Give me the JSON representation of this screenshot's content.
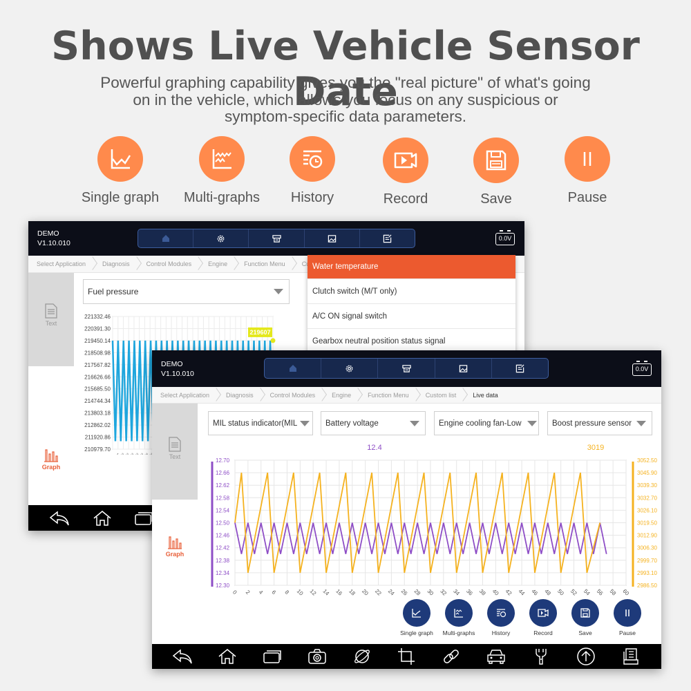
{
  "banner": {
    "title": "Shows Live Vehicle Sensor Date",
    "subtitle_lines": [
      "Powerful graphing capability gives you the \"real picture\" of what's  going",
      "on in the vehicle, which allows you focus on any suspicious or",
      "symptom-specific data parameters."
    ],
    "accent_color": "#ff8a4c",
    "features": [
      {
        "icon": "single-graph-icon",
        "label": "Single graph"
      },
      {
        "icon": "multi-graphs-icon",
        "label": "Multi-graphs"
      },
      {
        "icon": "history-icon",
        "label": "History"
      },
      {
        "icon": "record-icon",
        "label": "Record"
      },
      {
        "icon": "save-icon",
        "label": "Save"
      },
      {
        "icon": "pause-icon",
        "label": "Pause"
      }
    ]
  },
  "back_screen": {
    "mode": "DEMO",
    "version": "V1.10.010",
    "battery": "0.0V",
    "toolbar_icons": [
      "home-icon",
      "settings-icon",
      "obd-connector-icon",
      "image-icon",
      "report-icon"
    ],
    "breadcrumb": [
      "Select Application",
      "Diagnosis",
      "Control Modules",
      "Engine",
      "Function Menu",
      "Cus"
    ],
    "side_tabs": {
      "text": "Text",
      "graph": "Graph"
    },
    "selected_param": "Fuel pressure",
    "dropdown_options": [
      {
        "label": "Water temperature",
        "selected": true
      },
      {
        "label": "Clutch switch (M/T only)",
        "selected": false
      },
      {
        "label": "A/C ON signal switch",
        "selected": false
      },
      {
        "label": "Gearbox neutral position status signal",
        "selected": false
      }
    ],
    "chart": {
      "y_ticks": [
        "221332.46",
        "220391.30",
        "219450.14",
        "218508.98",
        "217567.82",
        "216626.66",
        "215685.50",
        "214744.34",
        "213803.18",
        "212862.02",
        "211920.86",
        "210979.70"
      ],
      "current_value": "219607",
      "line_color": "#1fa6dd",
      "marker_color": "#e4e81c"
    },
    "bottom_icons": [
      "back-icon",
      "home-icon",
      "recent-apps-icon"
    ]
  },
  "front_screen": {
    "mode": "DEMO",
    "version": "V1.10.010",
    "battery": "0.0V",
    "toolbar_icons": [
      "home-icon",
      "settings-icon",
      "obd-connector-icon",
      "image-icon",
      "report-icon"
    ],
    "breadcrumb": [
      "Select Application",
      "Diagnosis",
      "Control Modules",
      "Engine",
      "Function Menu",
      "Custom list",
      "Live data"
    ],
    "side_tabs": {
      "text": "Text",
      "graph": "Graph"
    },
    "param_selects": [
      "MIL status indicator(MIL",
      "Battery voltage",
      "Engine cooling fan-Low",
      "Boost pressure sensor"
    ],
    "actions": [
      {
        "icon": "single-graph-icon",
        "label": "Single graph"
      },
      {
        "icon": "multi-graphs-icon",
        "label": "Multi-graphs"
      },
      {
        "icon": "history-icon",
        "label": "History"
      },
      {
        "icon": "record-icon",
        "label": "Record"
      },
      {
        "icon": "save-icon",
        "label": "Save"
      },
      {
        "icon": "pause-icon",
        "label": "Pause"
      }
    ],
    "action_color": "#1e3a7a",
    "bottom_icons": [
      "back-icon",
      "home-icon",
      "recent-apps-icon",
      "camera-icon",
      "browser-icon",
      "crop-icon",
      "link-icon",
      "car-icon",
      "wrench-icon",
      "upload-icon",
      "manual-icon"
    ]
  },
  "chart_data": [
    {
      "type": "line",
      "title": "Fuel pressure",
      "ylim": [
        210979.7,
        221332.46
      ],
      "y_ticks": [
        221332.46,
        220391.3,
        219450.14,
        218508.98,
        217567.82,
        216626.66,
        215685.5,
        214744.34,
        213803.18,
        212862.02,
        211920.86,
        210979.7
      ],
      "series": [
        {
          "name": "Fuel pressure",
          "color": "#1fa6dd",
          "pattern": "zigzag",
          "high": 219450,
          "low": 211600,
          "points": 60
        }
      ],
      "annotations": [
        {
          "text": "219607",
          "position": "top-right"
        }
      ]
    },
    {
      "type": "line",
      "title": "",
      "xlabel": "",
      "ylabel": "",
      "x_ticks": [
        0,
        2,
        4,
        6,
        8,
        10,
        12,
        14,
        16,
        18,
        20,
        22,
        24,
        26,
        28,
        30,
        32,
        34,
        36,
        38,
        40,
        42,
        44,
        46,
        48,
        50,
        52,
        54,
        56,
        58,
        60
      ],
      "xlim": [
        0,
        60
      ],
      "grid": true,
      "y_left": {
        "ticks": [
          12.7,
          12.66,
          12.62,
          12.58,
          12.54,
          12.5,
          12.46,
          12.42,
          12.38,
          12.34,
          12.3
        ],
        "range": [
          12.3,
          12.7
        ],
        "color": "#8e4ec6",
        "header_value": "12.4"
      },
      "y_right": {
        "ticks": [
          3052.5,
          3045.9,
          3039.3,
          3032.7,
          3026.1,
          3019.5,
          3012.9,
          3006.3,
          2999.7,
          2993.1,
          2986.5
        ],
        "range": [
          2986.5,
          3052.5
        ],
        "color": "#f5b21f",
        "header_value": "3019"
      },
      "series": [
        {
          "name": "Battery voltage",
          "axis": "left",
          "color": "#8e4ec6",
          "x": [
            0,
            1,
            2,
            3,
            4,
            5,
            6,
            7,
            8,
            9,
            10,
            11,
            12,
            13,
            14,
            15,
            16,
            17,
            18,
            19,
            20,
            21,
            22,
            23,
            24,
            25,
            26,
            27,
            28,
            29,
            30,
            31,
            32,
            33,
            34,
            35,
            36,
            37,
            38,
            39,
            40,
            41,
            42,
            43,
            44,
            45,
            46,
            47,
            48,
            49,
            50,
            51,
            52,
            53,
            54,
            55,
            56,
            57
          ],
          "y": [
            12.5,
            12.4,
            12.5,
            12.4,
            12.5,
            12.4,
            12.5,
            12.4,
            12.5,
            12.4,
            12.5,
            12.4,
            12.5,
            12.4,
            12.5,
            12.4,
            12.5,
            12.4,
            12.5,
            12.4,
            12.5,
            12.4,
            12.5,
            12.4,
            12.5,
            12.4,
            12.5,
            12.4,
            12.5,
            12.4,
            12.5,
            12.4,
            12.5,
            12.4,
            12.5,
            12.4,
            12.5,
            12.4,
            12.5,
            12.4,
            12.5,
            12.4,
            12.5,
            12.4,
            12.5,
            12.4,
            12.5,
            12.4,
            12.5,
            12.4,
            12.5,
            12.4,
            12.5,
            12.4,
            12.5,
            12.4,
            12.5,
            12.4
          ]
        },
        {
          "name": "Boost pressure sensor",
          "axis": "right",
          "color": "#f5b21f",
          "x": [
            0,
            1,
            2,
            5,
            6,
            9,
            10,
            13,
            14,
            17,
            18,
            21,
            22,
            25,
            26,
            29,
            30,
            33,
            34,
            37,
            38,
            41,
            42,
            45,
            46,
            49,
            50,
            53,
            54,
            56
          ],
          "y": [
            3019.5,
            3045.9,
            2993.1,
            3045.9,
            2993.1,
            3045.9,
            2993.1,
            3045.9,
            2993.1,
            3045.9,
            2993.1,
            3045.9,
            2993.1,
            3045.9,
            2993.1,
            3045.9,
            2993.1,
            3045.9,
            2993.1,
            3045.9,
            2993.1,
            3045.9,
            2993.1,
            3045.9,
            2993.1,
            3045.9,
            2993.1,
            3045.9,
            2993.1,
            3019.5
          ]
        }
      ]
    }
  ]
}
